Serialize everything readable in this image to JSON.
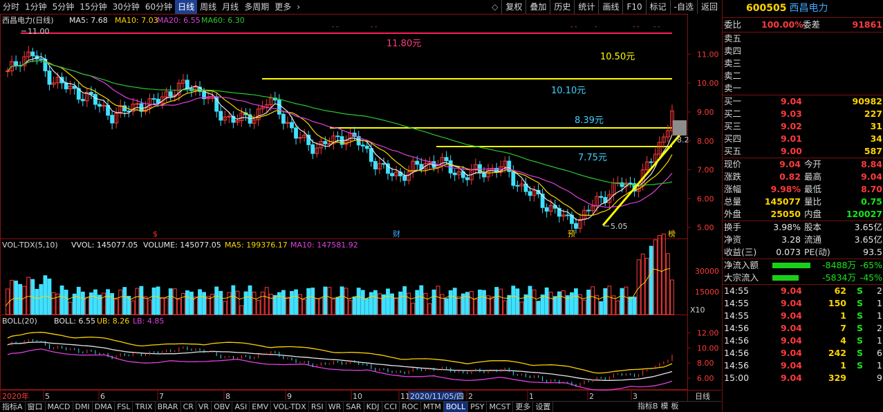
{
  "topbar": {
    "periods": [
      "分时",
      "1分钟",
      "5分钟",
      "15分钟",
      "30分钟",
      "60分钟",
      "日线",
      "周线",
      "月线",
      "多周期",
      "更多"
    ],
    "active_period": "日线",
    "more_arrow": "chevron-right-icon",
    "tools": [
      "复权",
      "叠加",
      "历史",
      "统计",
      "画线",
      "F10",
      "标记",
      "-自选",
      "返回"
    ],
    "diamond_icon": "diamond-icon"
  },
  "main_chart": {
    "legend": {
      "name": "西昌电力(日线)",
      "ma5": "MA5: 7.68",
      "ma10": "MA10: 7.03",
      "ma20": "MA20: 6.55",
      "ma60": "MA60: 6.30"
    },
    "price_ticks": [
      "11.00",
      "10.00",
      "9.00",
      "8.00",
      "7.00",
      "6.00",
      "5.00"
    ],
    "annotations": [
      "11.80元",
      "10.50元",
      "10.10元",
      "8.39元",
      "7.75元"
    ],
    "high_label": "11.00",
    "low_label": "5.05",
    "last_label": "8.2",
    "event_marks": [
      "$",
      "财",
      "预",
      "榜"
    ]
  },
  "vol_panel": {
    "legend": {
      "name": "VOL-TDX(5,10)",
      "vvol": "VVOL: 145077.05",
      "volume": "VOLUME: 145077.05",
      "ma5": "MA5: 199376.17",
      "ma10": "MA10: 147581.92"
    },
    "ticks": [
      "30000",
      "15000"
    ],
    "unit": "X10"
  },
  "boll_panel": {
    "legend": {
      "name": "BOLL(20)",
      "boll": "BOLL: 6.55",
      "ub": "UB: 8.26",
      "lb": "LB: 4.85"
    },
    "ticks": [
      "12.00",
      "10.00",
      "8.00",
      "6.00"
    ]
  },
  "x_axis": {
    "labels": [
      "2020年",
      "5",
      "6",
      "7",
      "8",
      "9",
      "10",
      "11",
      "2020/11/05/四",
      "2",
      "1",
      "2",
      "3"
    ],
    "right_label": "日线"
  },
  "bottom_tabs": [
    "指标A",
    "窗口",
    "MACD",
    "DMI",
    "DMA",
    "FSL",
    "TRIX",
    "BRAR",
    "CR",
    "VR",
    "OBV",
    "ASI",
    "EMV",
    "VOL-TDX",
    "RSI",
    "WR",
    "SAR",
    "KDJ",
    "CCI",
    "ROC",
    "MTM",
    "BOLL",
    "PSY",
    "MCST",
    "更多",
    "设置"
  ],
  "bottom_active": "BOLL",
  "bottom_right": [
    "指标B",
    "模",
    "板"
  ],
  "stock": {
    "code": "600505",
    "name": "西昌电力"
  },
  "quote": {
    "weibi_label": "委比",
    "weibi": "100.00%",
    "weicha_label": "委差",
    "weicha": "91861",
    "asks": [
      {
        "label": "卖五",
        "price": "",
        "vol": ""
      },
      {
        "label": "卖四",
        "price": "",
        "vol": ""
      },
      {
        "label": "卖三",
        "price": "",
        "vol": ""
      },
      {
        "label": "卖二",
        "price": "",
        "vol": ""
      },
      {
        "label": "卖一",
        "price": "",
        "vol": ""
      }
    ],
    "bids": [
      {
        "label": "买一",
        "price": "9.04",
        "vol": "90982"
      },
      {
        "label": "买二",
        "price": "9.03",
        "vol": "227"
      },
      {
        "label": "买三",
        "price": "9.02",
        "vol": "31"
      },
      {
        "label": "买四",
        "price": "9.01",
        "vol": "34"
      },
      {
        "label": "买五",
        "price": "9.00",
        "vol": "587"
      }
    ],
    "stats": [
      {
        "l1": "现价",
        "v1": "9.04",
        "l2": "今开",
        "v2": "8.84"
      },
      {
        "l1": "涨跌",
        "v1": "0.82",
        "l2": "最高",
        "v2": "9.04"
      },
      {
        "l1": "涨幅",
        "v1": "9.98%",
        "l2": "最低",
        "v2": "8.70"
      },
      {
        "l1": "总量",
        "v1": "145077",
        "l2": "量比",
        "v2": "0.75"
      },
      {
        "l1": "外盘",
        "v1": "25050",
        "l2": "内盘",
        "v2": "120027"
      }
    ],
    "stats2": [
      {
        "l1": "换手",
        "v1": "3.98%",
        "l2": "股本",
        "v2": "3.65亿"
      },
      {
        "l1": "净资",
        "v1": "3.28",
        "l2": "流通",
        "v2": "3.65亿"
      },
      {
        "l1": "收益(三)",
        "v1": "0.073",
        "l2": "PE(动)",
        "v2": "93.5"
      }
    ],
    "flows": [
      {
        "label": "净流入额",
        "amount": "-8488万",
        "pct": "-65%",
        "bar": 0.65
      },
      {
        "label": "大宗流入",
        "amount": "-5834万",
        "pct": "-45%",
        "bar": 0.45
      }
    ],
    "ticks": [
      {
        "time": "14:55",
        "price": "9.04",
        "vol": "62",
        "side": "S",
        "n": "2"
      },
      {
        "time": "14:55",
        "price": "9.04",
        "vol": "150",
        "side": "S",
        "n": "1"
      },
      {
        "time": "14:55",
        "price": "9.04",
        "vol": "1",
        "side": "S",
        "n": "1"
      },
      {
        "time": "14:56",
        "price": "9.04",
        "vol": "7",
        "side": "S",
        "n": "2"
      },
      {
        "time": "14:56",
        "price": "9.04",
        "vol": "4",
        "side": "S",
        "n": "1"
      },
      {
        "time": "14:56",
        "price": "9.04",
        "vol": "242",
        "side": "S",
        "n": "6"
      },
      {
        "time": "14:56",
        "price": "9.04",
        "vol": "1",
        "side": "S",
        "n": "1"
      },
      {
        "time": "15:00",
        "price": "9.04",
        "vol": "329",
        "side": "",
        "n": "9"
      }
    ]
  },
  "chart_data": {
    "type": "candlestick",
    "title": "西昌电力(日线)",
    "y_range": [
      4.8,
      12.2
    ],
    "price_levels": [
      11.8,
      10.5,
      10.1,
      8.39,
      7.75
    ],
    "period_high": 11.0,
    "period_low": 5.05,
    "last_close": 9.04,
    "ma": {
      "MA5": 7.68,
      "MA10": 7.03,
      "MA20": 6.55,
      "MA60": 6.3
    },
    "volume": {
      "VVOL": 145077.05,
      "MA5": 199376.17,
      "MA10": 147581.92,
      "ticks": [
        30000,
        15000
      ],
      "unit_multiplier": 10
    },
    "boll": {
      "BOLL": 6.55,
      "UB": 8.26,
      "LB": 4.85,
      "ticks": [
        12,
        10,
        8,
        6
      ]
    },
    "x_labels": [
      "2020年",
      "5",
      "6",
      "7",
      "8",
      "9",
      "10",
      "11",
      "2020/11/05/四",
      "2",
      "1",
      "2",
      "3"
    ],
    "close_path": [
      10.3,
      10.9,
      11.0,
      10.3,
      10.0,
      9.7,
      9.6,
      9.2,
      8.9,
      9.0,
      9.3,
      9.2,
      9.6,
      9.8,
      9.9,
      9.7,
      9.0,
      8.8,
      8.7,
      8.9,
      9.4,
      9.0,
      8.2,
      7.9,
      7.8,
      8.0,
      8.2,
      7.9,
      7.4,
      6.9,
      6.8,
      7.0,
      7.2,
      7.3,
      7.0,
      6.8,
      6.9,
      7.0,
      7.1,
      6.6,
      6.2,
      5.9,
      5.6,
      5.2,
      5.3,
      5.8,
      6.2,
      6.5,
      6.4,
      7.0,
      7.8,
      9.0
    ]
  }
}
